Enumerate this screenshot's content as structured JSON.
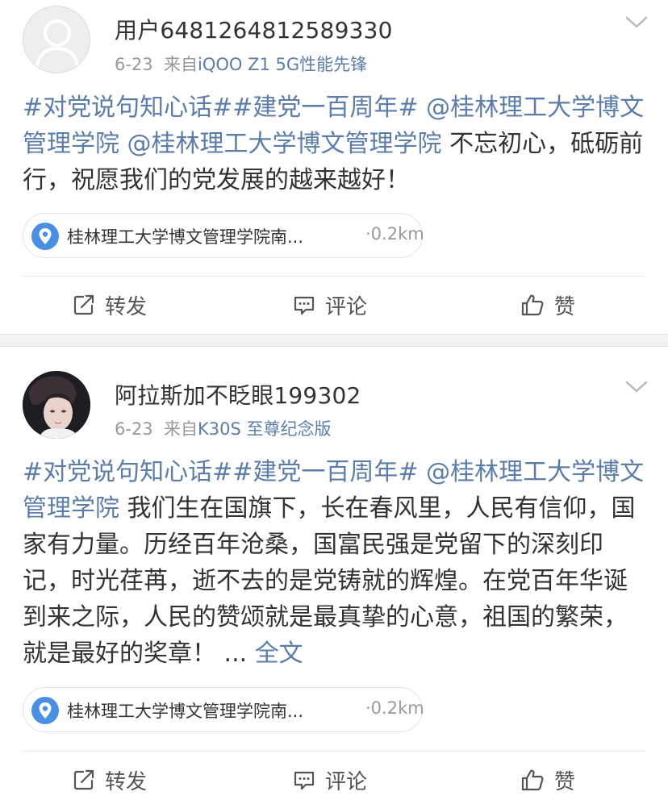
{
  "posts": [
    {
      "username": "用户6481264812589330",
      "date": "6-23",
      "source_prefix": "来自",
      "device": "iQOO Z1 5G性能先锋",
      "content": [
        {
          "text": "#对党说句知心话##建党一百周年# @桂林理工大学博文管理学院 @桂林理工大学博文管理学院",
          "link": true
        },
        {
          "text": " 不忘初心，砥砺前行，祝愿我们的党发展的越来越好！",
          "link": false
        }
      ],
      "location": {
        "name": "桂林理工大学博文管理学院南...",
        "distance": "·0.2km"
      },
      "actions": {
        "repost": "转发",
        "comment": "评论",
        "like": "赞"
      }
    },
    {
      "username": "阿拉斯加不眨眼199302",
      "date": "6-23",
      "source_prefix": "来自",
      "device": "K30S 至尊纪念版",
      "content": [
        {
          "text": "#对党说句知心话##建党一百周年# @桂林理工大学博文管理学院",
          "link": true
        },
        {
          "text": " 我们生在国旗下，长在春风里，人民有信仰，国家有力量。历经百年沧桑，国富民强是党留下的深刻印记，时光荏苒，逝不去的是党铸就的辉煌。在党百年华诞到来之际，人民的赞颂就是最真挚的心意，祖国的繁荣，就是最好的奖章！ ... ",
          "link": false
        },
        {
          "text": "全文",
          "link": true
        }
      ],
      "location": {
        "name": "桂林理工大学博文管理学院南...",
        "distance": "·0.2km"
      },
      "actions": {
        "repost": "转发",
        "comment": "评论",
        "like": "赞"
      }
    }
  ],
  "icons": {
    "more": "chevron-down-icon",
    "location": "location-pin-icon",
    "repost": "repost-icon",
    "comment": "comment-icon",
    "like": "thumbs-up-icon"
  },
  "colors": {
    "link": "#5b7da8",
    "text": "#333333",
    "meta": "#999999",
    "pin": "#4a90e2",
    "separator": "#f2f2f2"
  }
}
